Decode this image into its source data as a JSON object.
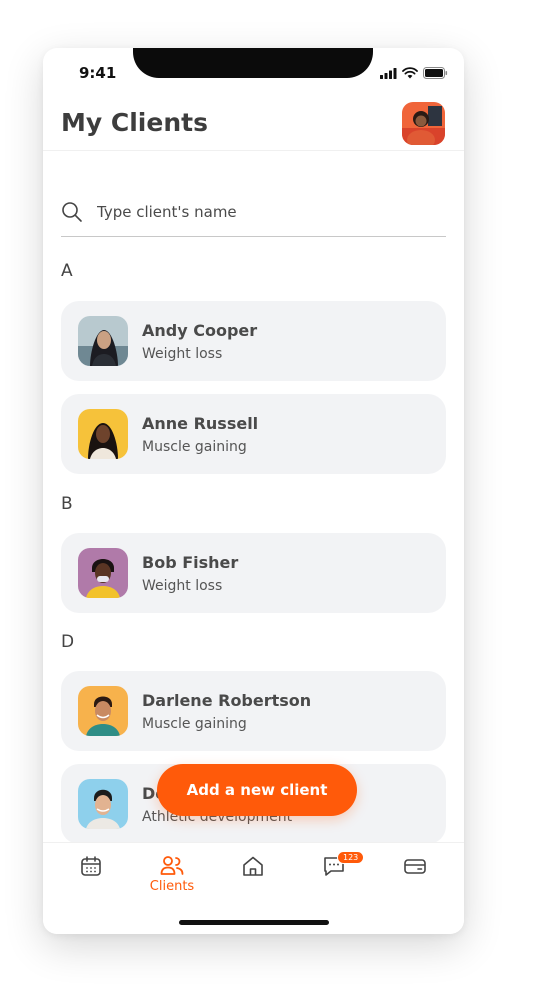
{
  "status_bar": {
    "time": "9:41"
  },
  "header": {
    "title": "My Clients"
  },
  "search": {
    "placeholder": "Type client's name"
  },
  "sections": [
    {
      "letter": "A",
      "clients": [
        {
          "name": "Andy Cooper",
          "goal": "Weight loss"
        },
        {
          "name": "Anne Russell",
          "goal": "Muscle gaining"
        }
      ]
    },
    {
      "letter": "B",
      "clients": [
        {
          "name": "Bob Fisher",
          "goal": "Weight loss"
        }
      ]
    },
    {
      "letter": "D",
      "clients": [
        {
          "name": "Darlene Robertson",
          "goal": "Muscle gaining"
        },
        {
          "name": "De",
          "goal": "Athletic development"
        }
      ]
    }
  ],
  "fab": {
    "label": "Add a new client"
  },
  "tabbar": {
    "items": [
      {
        "label": "",
        "icon": "calendar-icon"
      },
      {
        "label": "Clients",
        "icon": "clients-icon"
      },
      {
        "label": "",
        "icon": "home-icon"
      },
      {
        "label": "",
        "icon": "chat-icon",
        "badge": "123"
      },
      {
        "label": "",
        "icon": "card-icon"
      }
    ]
  },
  "colors": {
    "accent": "#ff5a0a",
    "card_bg": "#f2f3f5",
    "text": "#4a4a4a"
  }
}
